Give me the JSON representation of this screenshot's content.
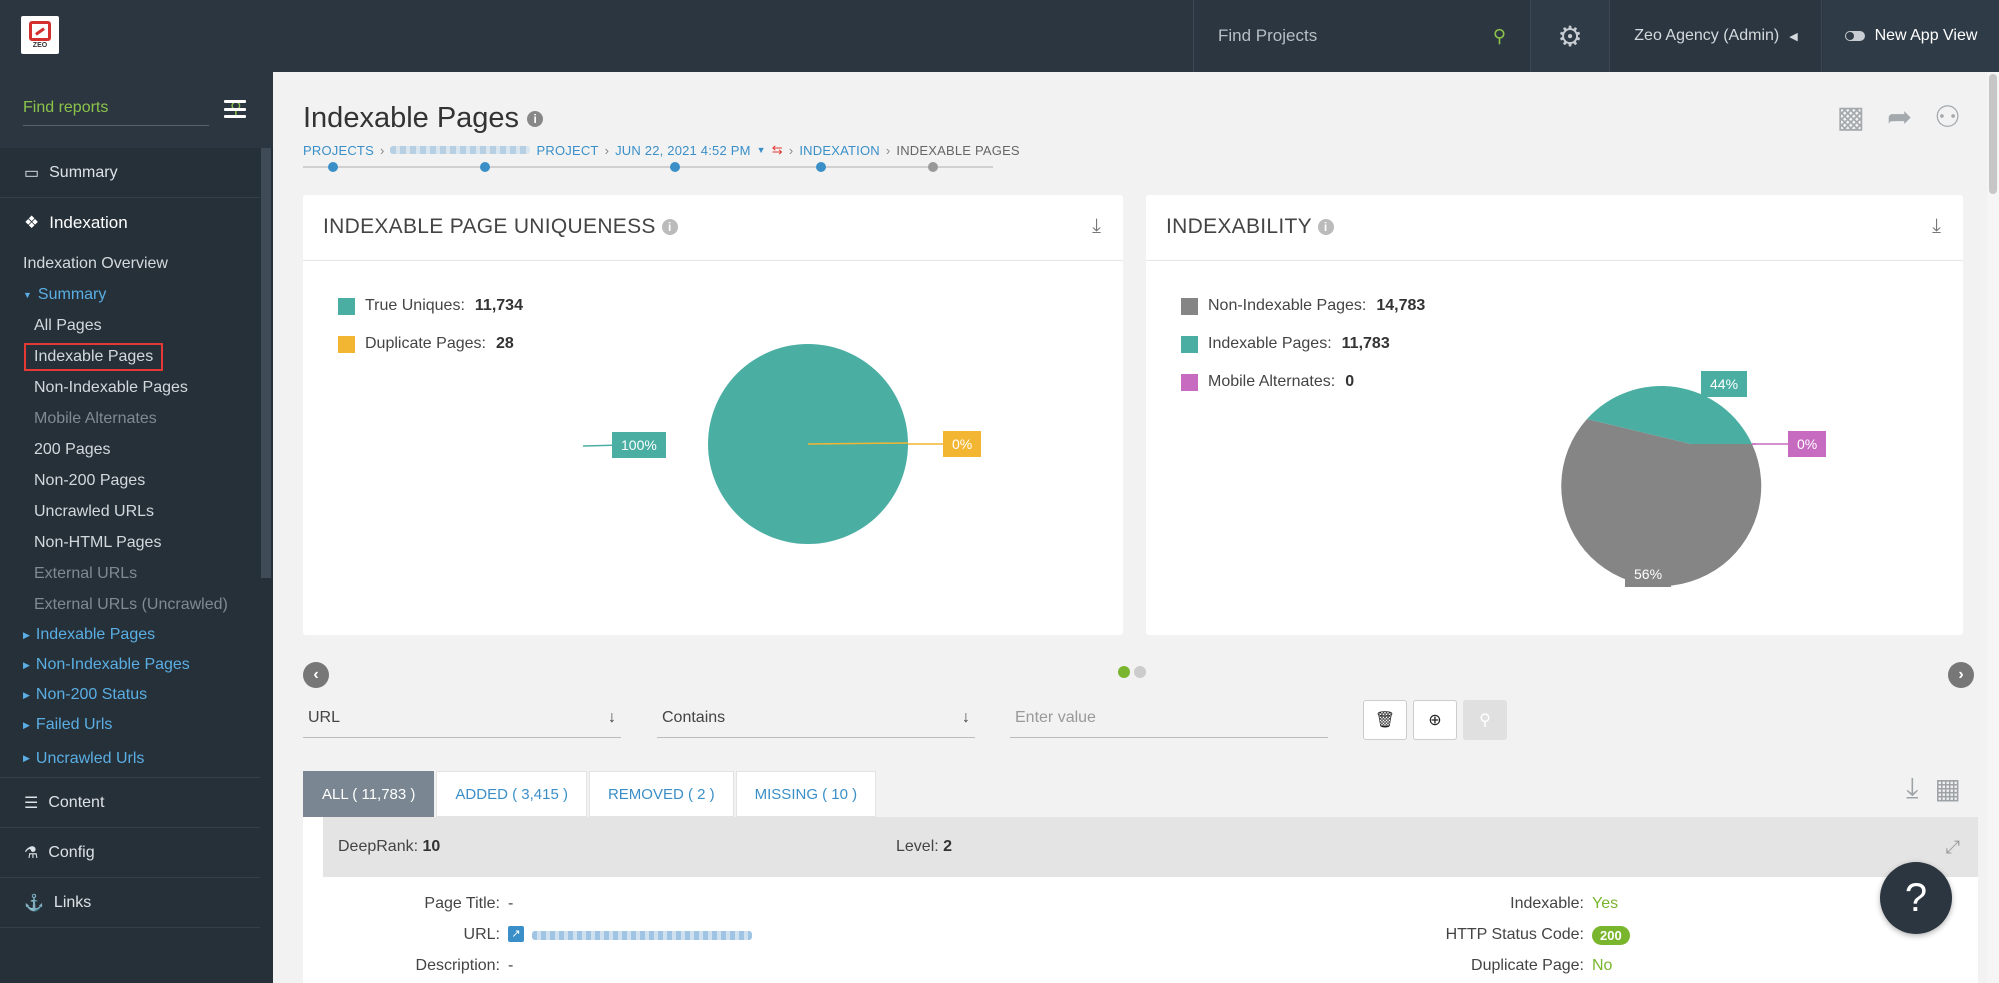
{
  "topbar": {
    "logo_text": "ZEO",
    "search_placeholder": "Find Projects",
    "user_label": "Zeo Agency (Admin)",
    "new_app_view_label": "New App View"
  },
  "sidebar": {
    "search_placeholder": "Find reports",
    "summary_label": "Summary",
    "indexation_label": "Indexation",
    "indexation_overview": "Indexation Overview",
    "summary_group": "Summary",
    "summary_items": {
      "all_pages": "All Pages",
      "indexable_pages": "Indexable Pages",
      "non_indexable_pages": "Non-Indexable Pages",
      "mobile_alternates": "Mobile Alternates",
      "pages_200": "200 Pages",
      "non_200_pages": "Non-200 Pages",
      "uncrawled_urls": "Uncrawled URLs",
      "non_html_pages": "Non-HTML Pages",
      "external_urls": "External URLs",
      "external_urls_uncrawled": "External URLs (Uncrawled)"
    },
    "groups": {
      "indexable_pages": "Indexable Pages",
      "non_indexable_pages": "Non-Indexable Pages",
      "non_200_status": "Non-200 Status",
      "failed_urls": "Failed Urls",
      "uncrawled_urls": "Uncrawled Urls"
    },
    "content_label": "Content",
    "config_label": "Config",
    "links_label": "Links"
  },
  "page": {
    "title": "Indexable Pages",
    "breadcrumb": {
      "projects": "PROJECTS",
      "project": "PROJECT",
      "date": "JUN 22, 2021 4:52 PM",
      "indexation": "INDEXATION",
      "current": "INDEXABLE PAGES"
    }
  },
  "uniqueness_card": {
    "title": "INDEXABLE PAGE UNIQUENESS",
    "legend": [
      {
        "label": "True Uniques:",
        "value": "11,734",
        "color": "#4aaea3"
      },
      {
        "label": "Duplicate Pages:",
        "value": "28",
        "color": "#f3b632"
      }
    ],
    "label_left": "100%",
    "label_right": "0%"
  },
  "indexability_card": {
    "title": "INDEXABILITY",
    "legend": [
      {
        "label": "Non-Indexable Pages:",
        "value": "14,783",
        "color": "#858585"
      },
      {
        "label": "Indexable Pages:",
        "value": "11,783",
        "color": "#4aaea3"
      },
      {
        "label": "Mobile Alternates:",
        "value": "0",
        "color": "#c76bc0"
      }
    ],
    "label_top": "44%",
    "label_right": "0%",
    "label_bottom": "56%"
  },
  "filters": {
    "field": "URL",
    "operator": "Contains",
    "value_placeholder": "Enter value"
  },
  "tabs": [
    {
      "label": "ALL ( 11,783 )"
    },
    {
      "label": "ADDED ( 3,415 )"
    },
    {
      "label": "REMOVED ( 2 )"
    },
    {
      "label": "MISSING ( 10 )"
    }
  ],
  "detail": {
    "deeprank_label": "DeepRank:",
    "deeprank_value": "10",
    "level_label": "Level:",
    "level_value": "2",
    "page_title_label": "Page Title:",
    "page_title_value": "-",
    "url_label": "URL:",
    "description_label": "Description:",
    "description_value": "-",
    "indexable_label": "Indexable:",
    "indexable_value": "Yes",
    "http_status_label": "HTTP Status Code:",
    "http_status_value": "200",
    "duplicate_label": "Duplicate Page:",
    "duplicate_value": "No"
  },
  "help_label": "?",
  "colors": {
    "accent": "#3a8fc8",
    "green": "#7ab52e",
    "teal": "#4aaea3",
    "dark": "#2b3640"
  }
}
